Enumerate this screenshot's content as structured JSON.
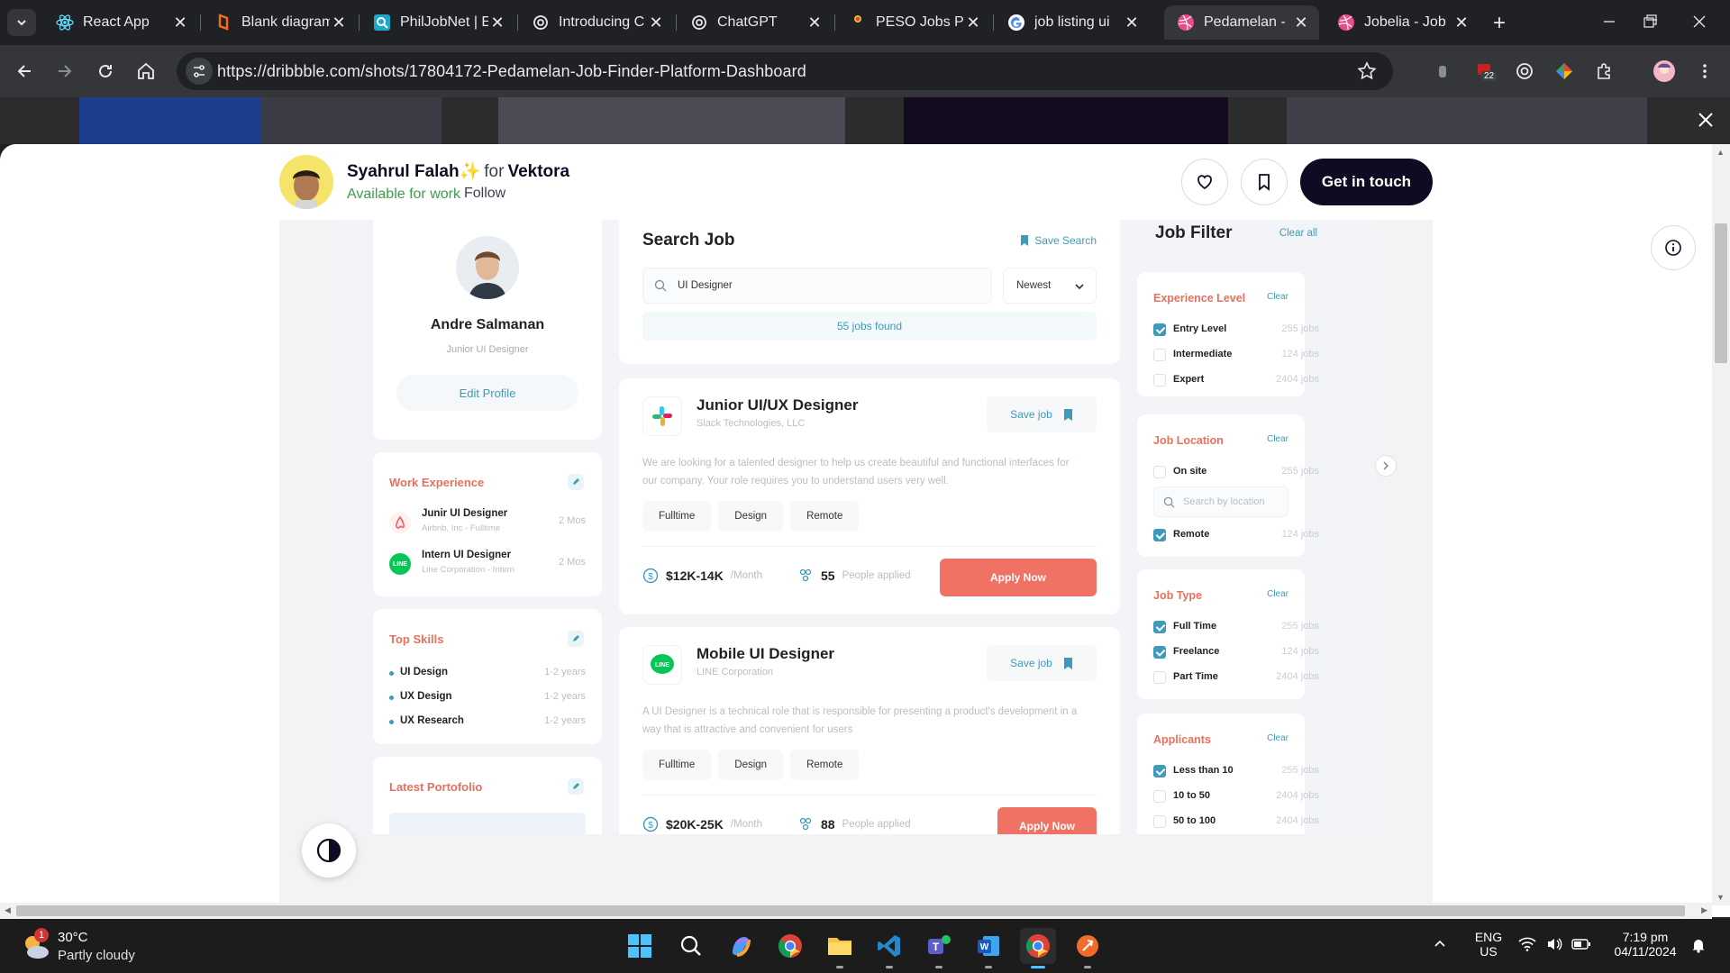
{
  "browser": {
    "tabs": [
      {
        "title": "React App",
        "icon": "react-icon",
        "active": false
      },
      {
        "title": "Blank diagram",
        "icon": "lucidchart-icon",
        "active": false
      },
      {
        "title": "PhilJobNet | E",
        "icon": "philjobnet-icon",
        "active": false
      },
      {
        "title": "Introducing C",
        "icon": "openai-icon",
        "active": false
      },
      {
        "title": "ChatGPT",
        "icon": "openai-icon",
        "active": false
      },
      {
        "title": "PESO Jobs Pl",
        "icon": "peso-icon",
        "active": false
      },
      {
        "title": "job listing ui",
        "icon": "google-icon",
        "active": false
      },
      {
        "title": "Pedamelan -",
        "icon": "dribbble-icon",
        "active": true
      },
      {
        "title": "Jobelia - Job",
        "icon": "dribbble-icon",
        "active": false
      }
    ],
    "url": "https://dribbble.com/shots/17804172-Pedamelan-Job-Finder-Platform-Dashboard",
    "extension_badge": "22"
  },
  "shot": {
    "designer": "Syahrul Falah",
    "sparkle": "✨",
    "for_label": "for",
    "team": "Vektora",
    "availability": "Available for work",
    "follow": "Follow",
    "cta": "Get in touch"
  },
  "profile": {
    "name": "Andre Salmanan",
    "role": "Junior UI Designer",
    "edit_label": "Edit Profile"
  },
  "work_experience": {
    "title": "Work Experience",
    "items": [
      {
        "title": "Junir UI Designer",
        "sub": "Airbnb, Inc - Fulltime",
        "duration": "2 Mos"
      },
      {
        "title": "Intern UI Designer",
        "sub": "Line Corporation - Intern",
        "duration": "2 Mos"
      }
    ]
  },
  "top_skills": {
    "title": "Top Skills",
    "items": [
      {
        "name": "UI Design",
        "years": "1-2 years"
      },
      {
        "name": "UX Design",
        "years": "1-2 years"
      },
      {
        "name": "UX Research",
        "years": "1-2 years"
      }
    ]
  },
  "portfolio": {
    "title": "Latest Portofolio"
  },
  "search": {
    "title": "Search Job",
    "save_label": "Save Search",
    "query": "UI Designer",
    "sort": "Newest",
    "found": "55 jobs found"
  },
  "jobs": [
    {
      "title": "Junior UI/UX Designer",
      "company": "Slack Technologies, LLC",
      "save_label": "Save job",
      "description": "We are looking for a talented designer to help us create beautiful and functional interfaces for our company. Your role requires you to understand users very well.",
      "tags": [
        "Fulltime",
        "Design",
        "Remote"
      ],
      "salary": "$12K-14K",
      "per": "/Month",
      "applied_count": "55",
      "applied_label": "People applied",
      "apply_label": "Apply Now"
    },
    {
      "title": "Mobile UI Designer",
      "company": "LINE Corporation",
      "save_label": "Save job",
      "description": "A UI Designer is a technical role that is responsible for presenting a product's development in a way that is attractive and convenient for users",
      "tags": [
        "Fulltime",
        "Design",
        "Remote"
      ],
      "salary": "$20K-25K",
      "per": "/Month",
      "applied_count": "88",
      "applied_label": "People applied",
      "apply_label": "Apply Now"
    }
  ],
  "filter": {
    "title": "Job Filter",
    "clear_all": "Clear all",
    "clear": "Clear",
    "experience": {
      "title": "Experience Level",
      "options": [
        {
          "label": "Entry Level",
          "count": "255 jobs",
          "checked": true
        },
        {
          "label": "Intermediate",
          "count": "124 jobs",
          "checked": false
        },
        {
          "label": "Expert",
          "count": "2404 jobs",
          "checked": false
        }
      ]
    },
    "location": {
      "title": "Job Location",
      "placeholder": "Search by location",
      "options": [
        {
          "label": "On site",
          "count": "255 jobs",
          "checked": false
        },
        {
          "label": "Remote",
          "count": "124 jobs",
          "checked": true
        }
      ]
    },
    "job_type": {
      "title": "Job Type",
      "options": [
        {
          "label": "Full Time",
          "count": "255 jobs",
          "checked": true
        },
        {
          "label": "Freelance",
          "count": "124 jobs",
          "checked": true
        },
        {
          "label": "Part Time",
          "count": "2404 jobs",
          "checked": false
        }
      ]
    },
    "applicants": {
      "title": "Applicants",
      "options": [
        {
          "label": "Less than 10",
          "count": "255 jobs",
          "checked": true
        },
        {
          "label": "10 to 50",
          "count": "2404 jobs",
          "checked": false
        },
        {
          "label": "50 to 100",
          "count": "2404 jobs",
          "checked": false
        }
      ]
    }
  },
  "taskbar": {
    "weather_badge": "1",
    "temperature": "30°C",
    "weather": "Partly cloudy",
    "lang": "ENG",
    "region": "US",
    "time": "7:19 pm",
    "date": "04/11/2024"
  },
  "colors": {
    "accent": "#3e9ab8",
    "coral": "#ef7264",
    "section_title": "#e8705e",
    "cta": "#0d0c22"
  }
}
